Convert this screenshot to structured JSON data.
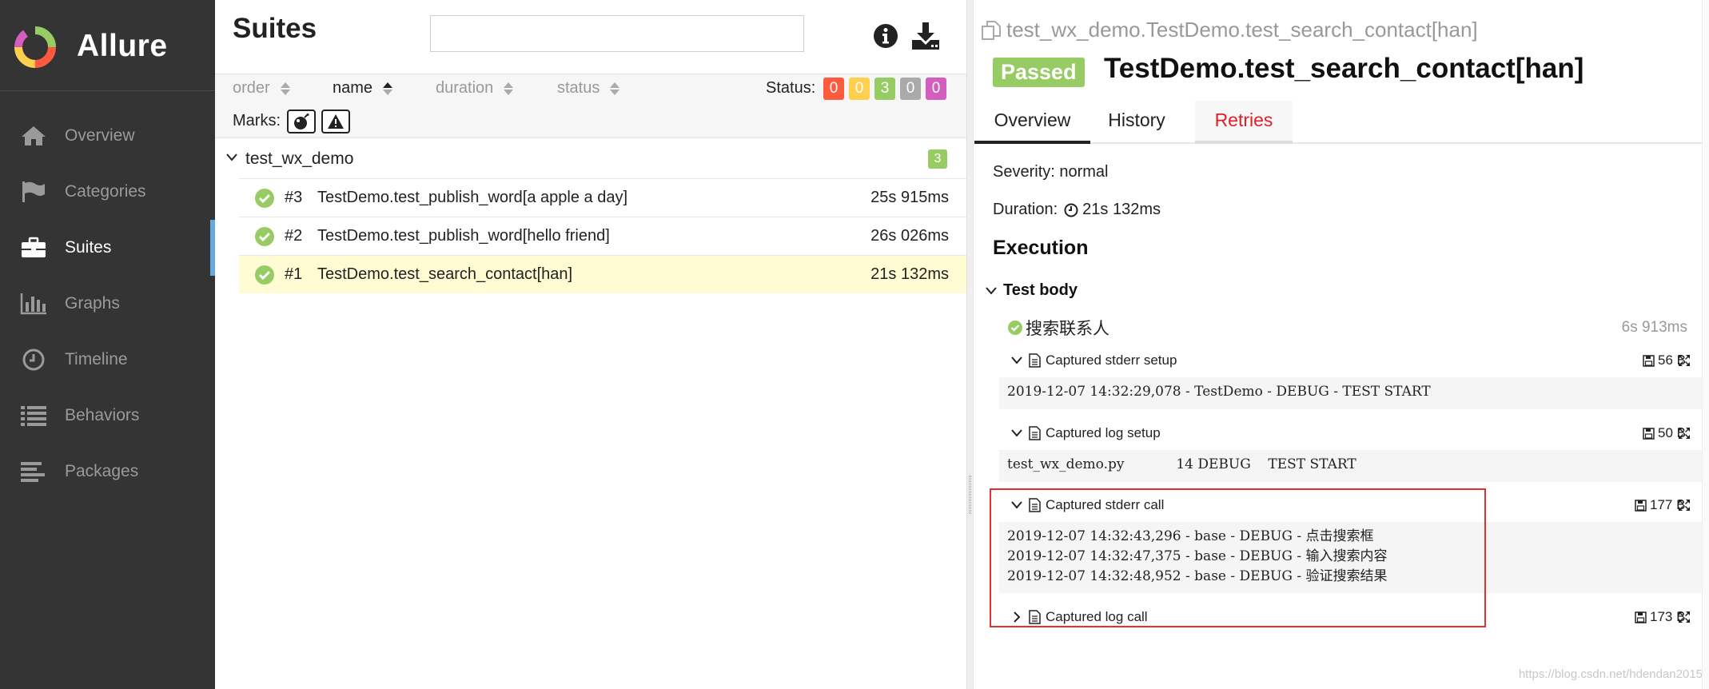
{
  "app": {
    "name": "Allure"
  },
  "sidebar": {
    "items": [
      {
        "label": "Overview",
        "icon": "home-icon"
      },
      {
        "label": "Categories",
        "icon": "flag-icon"
      },
      {
        "label": "Suites",
        "icon": "briefcase-icon",
        "active": true
      },
      {
        "label": "Graphs",
        "icon": "bar-chart-icon"
      },
      {
        "label": "Timeline",
        "icon": "clock-icon"
      },
      {
        "label": "Behaviors",
        "icon": "list-icon"
      },
      {
        "label": "Packages",
        "icon": "align-left-icon"
      }
    ]
  },
  "suites": {
    "title": "Suites",
    "search": {
      "value": "",
      "placeholder": ""
    },
    "sort": {
      "order": "order",
      "name": "name",
      "duration": "duration",
      "status": "status"
    },
    "status_label": "Status:",
    "status_counts": [
      {
        "value": "0",
        "color": "#fd5a3e"
      },
      {
        "value": "0",
        "color": "#ffd050"
      },
      {
        "value": "3",
        "color": "#97cc64"
      },
      {
        "value": "0",
        "color": "#aaaaaa"
      },
      {
        "value": "0",
        "color": "#d35ebe"
      }
    ],
    "marks_label": "Marks:",
    "group": {
      "name": "test_wx_demo",
      "count": "3"
    },
    "rows": [
      {
        "num": "#3",
        "name": "TestDemo.test_publish_word[a apple a day]",
        "duration": "25s 915ms"
      },
      {
        "num": "#2",
        "name": "TestDemo.test_publish_word[hello friend]",
        "duration": "26s 026ms"
      },
      {
        "num": "#1",
        "name": "TestDemo.test_search_contact[han]",
        "duration": "21s 132ms",
        "selected": true
      }
    ]
  },
  "detail": {
    "breadcrumb": "test_wx_demo.TestDemo.test_search_contact[han]",
    "status": "Passed",
    "title": "TestDemo.test_search_contact[han]",
    "tabs": [
      "Overview",
      "History",
      "Retries"
    ],
    "severity": "Severity: normal",
    "duration_label": "Duration:",
    "duration_value": "21s 132ms",
    "execution": "Execution",
    "test_body": "Test body",
    "step": {
      "name": "搜索联系人",
      "time": "6s 913ms"
    },
    "attachments": [
      {
        "name": "Captured stderr setup",
        "size": "56 B",
        "content": "2019-12-07 14:32:29,078 - TestDemo - DEBUG - TEST START"
      },
      {
        "name": "Captured log setup",
        "size": "50 B",
        "content": "test_wx_demo.py            14 DEBUG    TEST START"
      },
      {
        "name": "Captured stderr call",
        "size": "177 B",
        "content": "2019-12-07 14:32:43,296 - base - DEBUG - 点击搜索框\n2019-12-07 14:32:47,375 - base - DEBUG - 输入搜索内容\n2019-12-07 14:32:48,952 - base - DEBUG - 验证搜索结果"
      },
      {
        "name": "Captured log call",
        "size": "173 B"
      }
    ]
  },
  "watermark": "https://blog.csdn.net/hdendan2015"
}
